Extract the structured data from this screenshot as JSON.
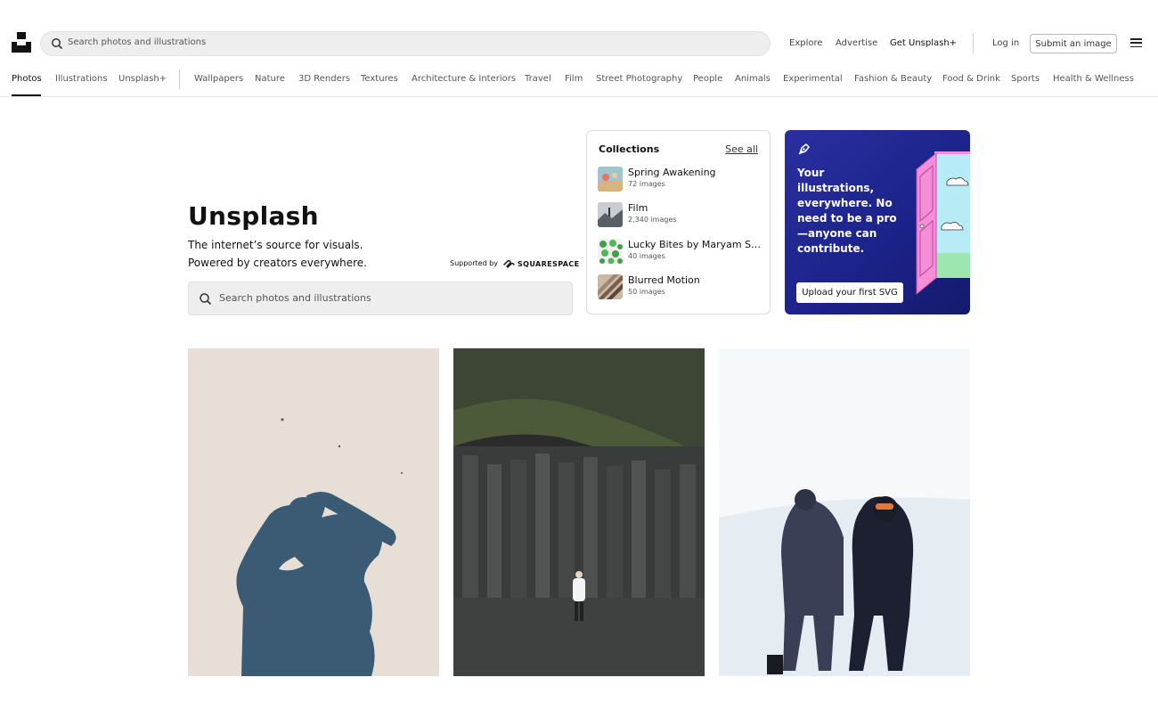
{
  "header": {
    "search_placeholder": "Search photos and illustrations",
    "explore": "Explore",
    "advertise": "Advertise",
    "get_plus": "Get Unsplash+",
    "login": "Log in",
    "submit": "Submit an image"
  },
  "nav": {
    "primary": [
      "Photos",
      "Illustrations",
      "Unsplash+"
    ],
    "categories": [
      "Wallpapers",
      "Nature",
      "3D Renders",
      "Textures",
      "Architecture & Interiors",
      "Travel",
      "Film",
      "Street Photography",
      "People",
      "Animals",
      "Experimental",
      "Fashion & Beauty",
      "Food & Drink",
      "Sports",
      "Health & Wellness"
    ]
  },
  "hero": {
    "title": "Unsplash",
    "line1": "The internet’s source for visuals.",
    "line2": "Powered by creators everywhere.",
    "supported_by": "Supported by",
    "sponsor": "SQUARESPACE",
    "search_placeholder": "Search photos and illustrations"
  },
  "collections": {
    "title": "Collections",
    "see_all": "See all",
    "items": [
      {
        "name": "Spring Awakening",
        "count": "72 images"
      },
      {
        "name": "Film",
        "count": "2,340 images"
      },
      {
        "name": "Lucky Bites by Maryam Sic...",
        "count": "40 images"
      },
      {
        "name": "Blurred Motion",
        "count": "50 images"
      }
    ]
  },
  "promo": {
    "text": "Your illustrations, everywhere. No need to be a pro—anyone can contribute.",
    "button": "Upload your first SVG"
  },
  "colors": {
    "promo_bg": "#1c238a",
    "search_bg": "#eeeeee",
    "accent_text": "#111111"
  }
}
